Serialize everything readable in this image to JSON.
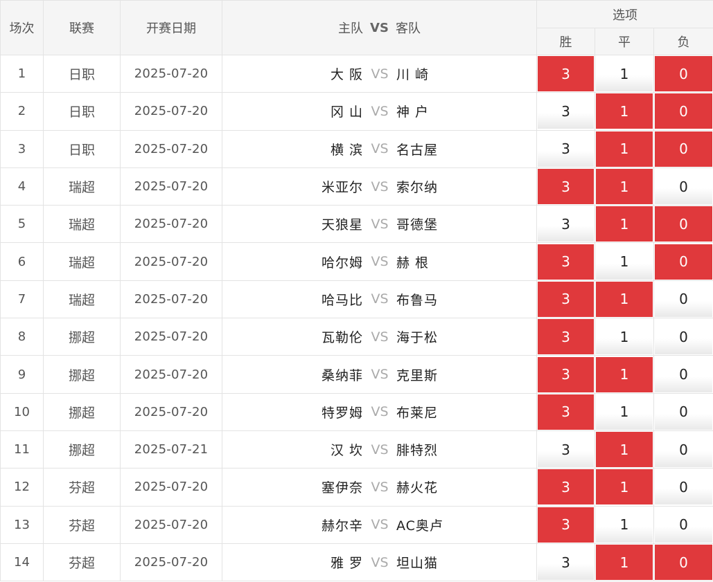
{
  "header": {
    "idx": "场次",
    "league": "联赛",
    "date": "开赛日期",
    "home": "主队",
    "vs": "VS",
    "away": "客队",
    "options": "选项",
    "win": "胜",
    "draw": "平",
    "loss": "负"
  },
  "vs_label": "VS",
  "rows": [
    {
      "idx": "1",
      "league": "日职",
      "date": "2025-07-20",
      "home": "大 阪",
      "away": "川 崎",
      "opts": [
        {
          "label": "3",
          "selected": true
        },
        {
          "label": "1",
          "selected": false
        },
        {
          "label": "0",
          "selected": true
        }
      ]
    },
    {
      "idx": "2",
      "league": "日职",
      "date": "2025-07-20",
      "home": "冈 山",
      "away": "神 户",
      "opts": [
        {
          "label": "3",
          "selected": false
        },
        {
          "label": "1",
          "selected": true
        },
        {
          "label": "0",
          "selected": true
        }
      ]
    },
    {
      "idx": "3",
      "league": "日职",
      "date": "2025-07-20",
      "home": "横 滨",
      "away": "名古屋",
      "opts": [
        {
          "label": "3",
          "selected": false
        },
        {
          "label": "1",
          "selected": true
        },
        {
          "label": "0",
          "selected": true
        }
      ]
    },
    {
      "idx": "4",
      "league": "瑞超",
      "date": "2025-07-20",
      "home": "米亚尔",
      "away": "索尔纳",
      "opts": [
        {
          "label": "3",
          "selected": true
        },
        {
          "label": "1",
          "selected": true
        },
        {
          "label": "0",
          "selected": false
        }
      ]
    },
    {
      "idx": "5",
      "league": "瑞超",
      "date": "2025-07-20",
      "home": "天狼星",
      "away": "哥德堡",
      "opts": [
        {
          "label": "3",
          "selected": false
        },
        {
          "label": "1",
          "selected": true
        },
        {
          "label": "0",
          "selected": true
        }
      ]
    },
    {
      "idx": "6",
      "league": "瑞超",
      "date": "2025-07-20",
      "home": "哈尔姆",
      "away": "赫 根",
      "opts": [
        {
          "label": "3",
          "selected": true
        },
        {
          "label": "1",
          "selected": false
        },
        {
          "label": "0",
          "selected": true
        }
      ]
    },
    {
      "idx": "7",
      "league": "瑞超",
      "date": "2025-07-20",
      "home": "哈马比",
      "away": "布鲁马",
      "opts": [
        {
          "label": "3",
          "selected": true
        },
        {
          "label": "1",
          "selected": true
        },
        {
          "label": "0",
          "selected": false
        }
      ]
    },
    {
      "idx": "8",
      "league": "挪超",
      "date": "2025-07-20",
      "home": "瓦勒伦",
      "away": "海于松",
      "opts": [
        {
          "label": "3",
          "selected": true
        },
        {
          "label": "1",
          "selected": false
        },
        {
          "label": "0",
          "selected": false
        }
      ]
    },
    {
      "idx": "9",
      "league": "挪超",
      "date": "2025-07-20",
      "home": "桑纳菲",
      "away": "克里斯",
      "opts": [
        {
          "label": "3",
          "selected": true
        },
        {
          "label": "1",
          "selected": true
        },
        {
          "label": "0",
          "selected": false
        }
      ]
    },
    {
      "idx": "10",
      "league": "挪超",
      "date": "2025-07-20",
      "home": "特罗姆",
      "away": "布莱尼",
      "opts": [
        {
          "label": "3",
          "selected": true
        },
        {
          "label": "1",
          "selected": false
        },
        {
          "label": "0",
          "selected": false
        }
      ]
    },
    {
      "idx": "11",
      "league": "挪超",
      "date": "2025-07-21",
      "home": "汉 坎",
      "away": "腓特烈",
      "opts": [
        {
          "label": "3",
          "selected": false
        },
        {
          "label": "1",
          "selected": true
        },
        {
          "label": "0",
          "selected": false
        }
      ]
    },
    {
      "idx": "12",
      "league": "芬超",
      "date": "2025-07-20",
      "home": "塞伊奈",
      "away": "赫火花",
      "opts": [
        {
          "label": "3",
          "selected": true
        },
        {
          "label": "1",
          "selected": true
        },
        {
          "label": "0",
          "selected": false
        }
      ]
    },
    {
      "idx": "13",
      "league": "芬超",
      "date": "2025-07-20",
      "home": "赫尔辛",
      "away": "AC奥卢",
      "opts": [
        {
          "label": "3",
          "selected": true
        },
        {
          "label": "1",
          "selected": false
        },
        {
          "label": "0",
          "selected": false
        }
      ]
    },
    {
      "idx": "14",
      "league": "芬超",
      "date": "2025-07-20",
      "home": "雅 罗",
      "away": "坦山猫",
      "opts": [
        {
          "label": "3",
          "selected": false
        },
        {
          "label": "1",
          "selected": true
        },
        {
          "label": "0",
          "selected": true
        }
      ]
    }
  ],
  "colors": {
    "selected_bg": "#e0393c",
    "header_bg": "#f5f5f5",
    "border": "#e3e3e3"
  }
}
